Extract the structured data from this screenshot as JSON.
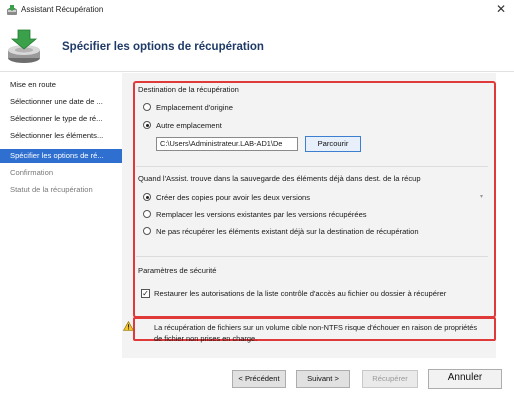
{
  "window": {
    "title": "Assistant Récupération",
    "close_glyph": "✕"
  },
  "header": {
    "title": "Spécifier les options de récupération"
  },
  "nav": {
    "items": [
      {
        "label": "Mise en route",
        "state": "normal"
      },
      {
        "label": "Sélectionner une date de ...",
        "state": "normal"
      },
      {
        "label": "Sélectionner le type de ré...",
        "state": "normal"
      },
      {
        "label": "Sélectionner les éléments...",
        "state": "normal"
      },
      {
        "label": "Spécifier les options de ré...",
        "state": "selected"
      },
      {
        "label": "Confirmation",
        "state": "disabled"
      },
      {
        "label": "Statut de la récupération",
        "state": "disabled"
      }
    ]
  },
  "destination": {
    "heading": "Destination de la récupération",
    "option_original": "Emplacement d'origine",
    "option_other": "Autre emplacement",
    "selected": "other",
    "path_value": "C:\\Users\\Administrateur.LAB-AD1\\De",
    "browse_label": "Parcourir"
  },
  "conflict": {
    "heading": "Quand l'Assist. trouve dans la sauvegarde des éléments déjà dans dest. de la récup",
    "options": [
      "Créer des copies pour avoir les deux versions",
      "Remplacer les versions existantes par les versions récupérées",
      "Ne pas récupérer les éléments existant déjà sur la destination de récupération"
    ],
    "selected_index": 0
  },
  "security": {
    "heading": "Paramètres de sécurité",
    "checkbox_label": "Restaurer les autorisations de la liste contrôle d'accès au fichier ou dossier à récupérer",
    "checked": true,
    "check_glyph": "✓"
  },
  "warning": {
    "text": "La récupération de fichiers sur un volume cible non-NTFS risque d'échouer en raison de propriétés de fichier non prises en charge."
  },
  "footer": {
    "previous_label": "< Précédent",
    "next_label": "Suivant >",
    "recover_label": "Récupérer",
    "cancel_label": "Annuler"
  },
  "colors": {
    "accent_selected": "#2e6fd0",
    "highlight_box": "#e0393a",
    "header_title": "#1e3a66"
  },
  "icons": [
    "app-icon",
    "backup-restore-icon",
    "warning-icon",
    "close-icon"
  ]
}
